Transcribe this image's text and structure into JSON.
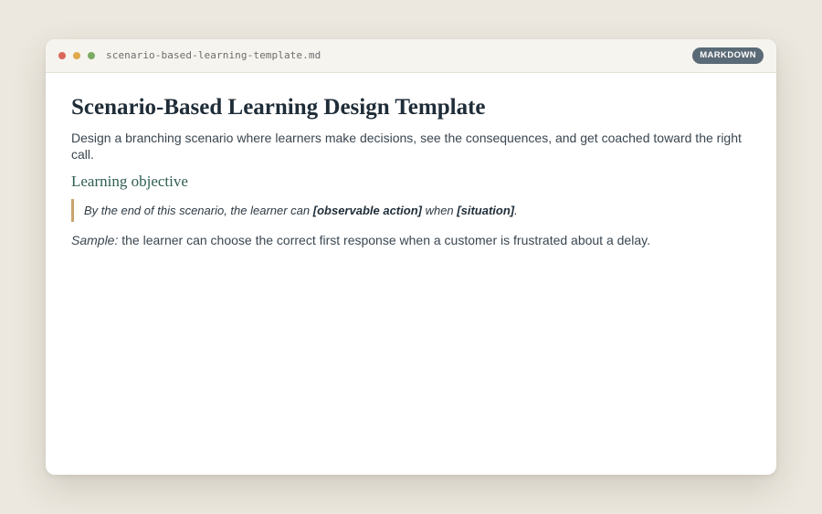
{
  "window": {
    "filename": "scenario-based-learning-template.md",
    "badge": "MARKDOWN"
  },
  "document": {
    "title": "Scenario-Based Learning Design Template",
    "intro": "Design a branching scenario where learners make decisions, see the consequences, and get coached toward the right call.",
    "objective_heading": "Learning objective",
    "objective_quote": {
      "prefix": "By the end of this scenario, the learner can ",
      "action": "[observable action]",
      "middle": " when ",
      "situation": "[situation]",
      "suffix": "."
    },
    "sample": {
      "label": "Sample:",
      "text": " the learner can choose the correct first response when a customer is frustrated about a delay."
    }
  },
  "colors": {
    "background": "#ece8df",
    "title": "#1f2d38",
    "heading_accent": "#2f5d52",
    "quote_border": "#c9a46a",
    "badge": "#5a6a76",
    "dot_close": "#d9685b",
    "dot_minimize": "#e0a94a",
    "dot_maximize": "#7aab62"
  }
}
